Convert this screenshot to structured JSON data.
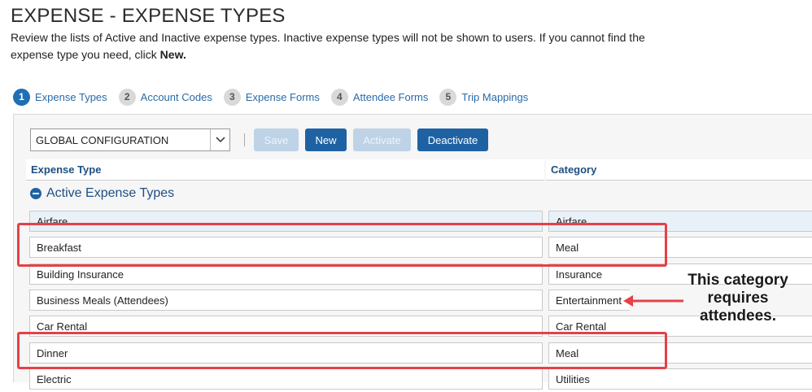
{
  "page": {
    "title": "EXPENSE - EXPENSE TYPES",
    "intro_text": "Review the lists of Active and Inactive expense types. Inactive expense types will not be shown to users. If you cannot find the expense type you need, click ",
    "intro_bold": "New."
  },
  "steps": [
    {
      "num": "1",
      "label": "Expense Types",
      "active": true
    },
    {
      "num": "2",
      "label": "Account Codes",
      "active": false
    },
    {
      "num": "3",
      "label": "Expense Forms",
      "active": false
    },
    {
      "num": "4",
      "label": "Attendee Forms",
      "active": false
    },
    {
      "num": "5",
      "label": "Trip Mappings",
      "active": false
    }
  ],
  "toolbar": {
    "config_select": "GLOBAL CONFIGURATION",
    "save_label": "Save",
    "new_label": "New",
    "activate_label": "Activate",
    "deactivate_label": "Deactivate"
  },
  "table": {
    "col_expense_type": "Expense Type",
    "col_category": "Category",
    "section_label": "Active Expense Types",
    "rows": [
      {
        "type": "Airfare",
        "category": "Airfare"
      },
      {
        "type": "Breakfast",
        "category": "Meal"
      },
      {
        "type": "Building Insurance",
        "category": "Insurance"
      },
      {
        "type": "Business Meals (Attendees)",
        "category": "Entertainment"
      },
      {
        "type": "Car Rental",
        "category": "Car Rental"
      },
      {
        "type": "Dinner",
        "category": "Meal"
      },
      {
        "type": "Electric",
        "category": "Utilities"
      }
    ]
  },
  "annotation": {
    "line1": "This category",
    "line2": "requires",
    "line3": "attendees.",
    "color": "#e64146"
  }
}
